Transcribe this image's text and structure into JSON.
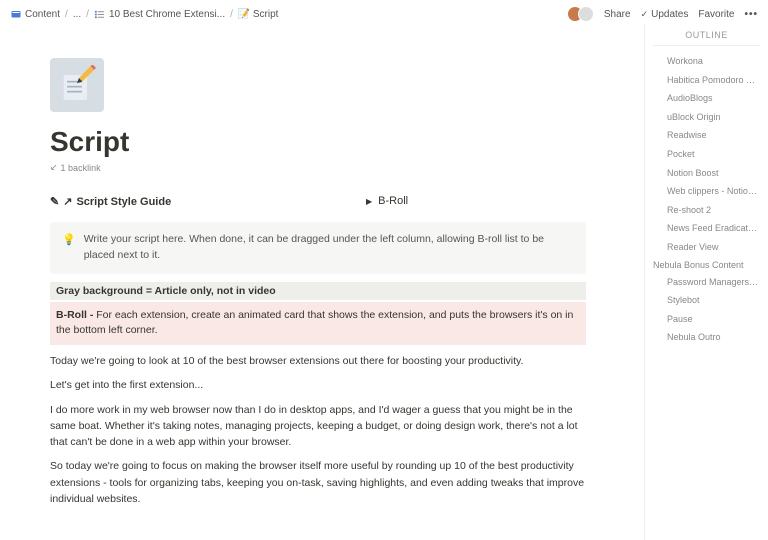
{
  "breadcrumb": {
    "root": "Content",
    "ellipsis": "...",
    "parent": "10 Best Chrome Extensi...",
    "current": "Script"
  },
  "topbar": {
    "share": "Share",
    "updates": "Updates",
    "favorite": "Favorite"
  },
  "page": {
    "title": "Script",
    "backlink_count": "1 backlink"
  },
  "columns": {
    "style_guide": "Script Style Guide",
    "broll": "B-Roll"
  },
  "callout": {
    "text": "Write your script here. When done, it can be dragged under the left column, allowing B-roll list to be placed next to it."
  },
  "blocks": {
    "gray": "Gray background = Article only, not in video",
    "pink_label": "B-Roll - ",
    "pink_rest": "For each extension, create an animated card that shows the extension, and puts the browsers it's on in the bottom left corner.",
    "p1": "Today we're going to look at 10 of the best browser extensions out there for boosting your productivity.",
    "p2": "Let's get into the first extension...",
    "p3": "I do more work in my web browser now than I do in desktop apps, and I'd wager a guess that you might be in the same boat. Whether it's taking notes, managing projects, keeping a budget, or doing design work, there's not a lot that can't be done in a web app within your browser.",
    "p4": "So today we're going to focus on making the browser itself more useful by rounding up 10 of the best productivity extensions - tools for organizing tabs, keeping you on-task, saving highlights, and even adding tweaks that improve individual websites."
  },
  "outline": {
    "title": "OUTLINE",
    "items": [
      {
        "label": "Workona",
        "indent": true
      },
      {
        "label": "Habitica Pomodoro Si...",
        "indent": true
      },
      {
        "label": "AudioBlogs",
        "indent": true
      },
      {
        "label": "uBlock Origin",
        "indent": true
      },
      {
        "label": "Readwise",
        "indent": true
      },
      {
        "label": "Pocket",
        "indent": true
      },
      {
        "label": "Notion Boost",
        "indent": true
      },
      {
        "label": "Web clippers - Notion...",
        "indent": true
      },
      {
        "label": "Re-shoot 2",
        "indent": true
      },
      {
        "label": "News Feed Eradicator ...",
        "indent": true
      },
      {
        "label": "Reader View",
        "indent": true
      }
    ],
    "group": "Nebula Bonus Content",
    "group_items": [
      {
        "label": "Password Managers - ..."
      },
      {
        "label": "Stylebot"
      },
      {
        "label": "Pause"
      },
      {
        "label": "Nebula Outro"
      }
    ]
  }
}
